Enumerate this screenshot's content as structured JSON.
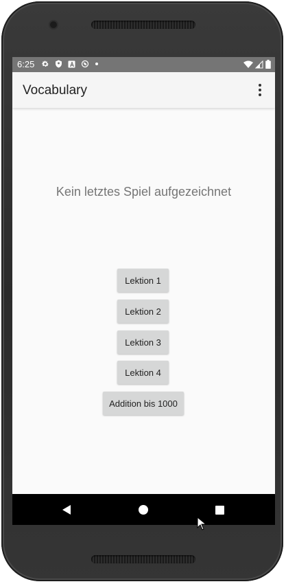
{
  "status_bar": {
    "time": "6:25",
    "icons_left": [
      "gear-icon",
      "shield-icon",
      "font-a-icon",
      "sync-circle-icon",
      "dot-icon"
    ],
    "icons_right": [
      "wifi-icon",
      "signal-icon",
      "battery-icon"
    ]
  },
  "app_bar": {
    "title": "Vocabulary",
    "overflow_icon": "more-vert-icon"
  },
  "main": {
    "message": "Kein letztes Spiel aufgezeichnet",
    "buttons": [
      {
        "label": "Lektion 1"
      },
      {
        "label": "Lektion 2"
      },
      {
        "label": "Lektion 3"
      },
      {
        "label": "Lektion 4"
      },
      {
        "label": "Addition bis 1000"
      }
    ]
  },
  "nav_bar": {
    "icons": [
      "back-icon",
      "home-icon",
      "recents-icon"
    ]
  },
  "colors": {
    "status_bar": "#757575",
    "app_bar": "#f5f5f5",
    "background": "#fafafa",
    "button": "#d6d7d7",
    "message_text": "#757575",
    "nav_bar": "#000000"
  }
}
